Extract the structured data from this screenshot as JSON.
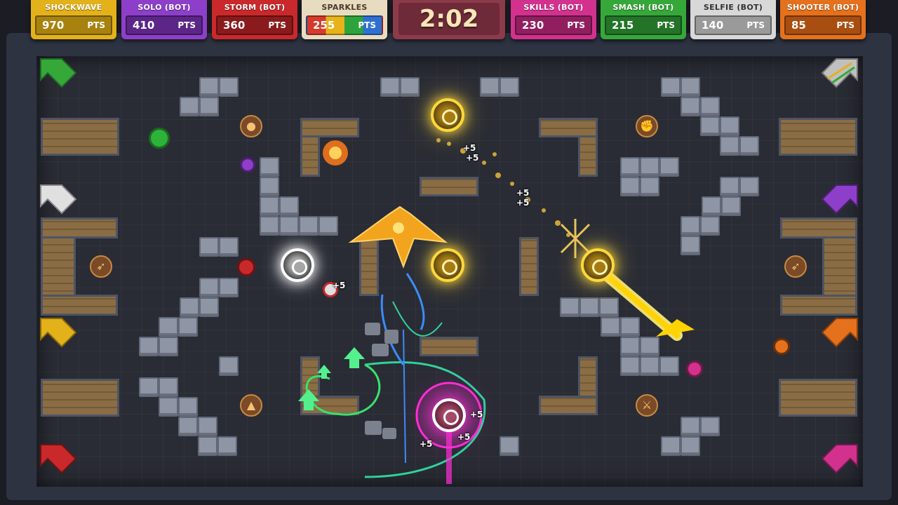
{
  "timer": "2:02",
  "pts_label": "PTS",
  "players": [
    {
      "name": "SHOCKWAVE (BOT)",
      "score": "970",
      "color": "#e3b11a",
      "dark": "#a8820e"
    },
    {
      "name": "SOLO (BOT)",
      "score": "410",
      "color": "#8d3fc9",
      "dark": "#5c2689"
    },
    {
      "name": "STORM (BOT)",
      "score": "360",
      "color": "#c9292b",
      "dark": "#8a1a1c"
    },
    {
      "name": "SPARKLES",
      "score": "255",
      "color": "#e8dcc0",
      "dark": "#b6a57e",
      "rainbow": true
    },
    {
      "name": "SKILLS (BOT)",
      "score": "230",
      "color": "#d2318e",
      "dark": "#911f60"
    },
    {
      "name": "SMASH (BOT)",
      "score": "215",
      "color": "#36a83a",
      "dark": "#237328"
    },
    {
      "name": "SELFIE (BOT)",
      "score": "140",
      "color": "#d8d8d8",
      "dark": "#9a9a9a"
    },
    {
      "name": "SHOOTER (BOT)",
      "score": "85",
      "color": "#e5711d",
      "dark": "#a84e10"
    }
  ],
  "float_texts": [
    "+5",
    "+5",
    "+5",
    "+5",
    "+5",
    "+5",
    "+5",
    "+5"
  ],
  "pickups": [
    "bomb-icon",
    "fist-icon",
    "bow-icon",
    "bow-icon",
    "dart-icon",
    "sword-icon",
    "boomerang-icon"
  ],
  "spawn_colors": [
    "#36a83a",
    "#c0c0c0",
    "#e3b11a",
    "#c9292b",
    "#e0e0e0",
    "#8d3fc9",
    "#e5711d",
    "#d2318e"
  ]
}
